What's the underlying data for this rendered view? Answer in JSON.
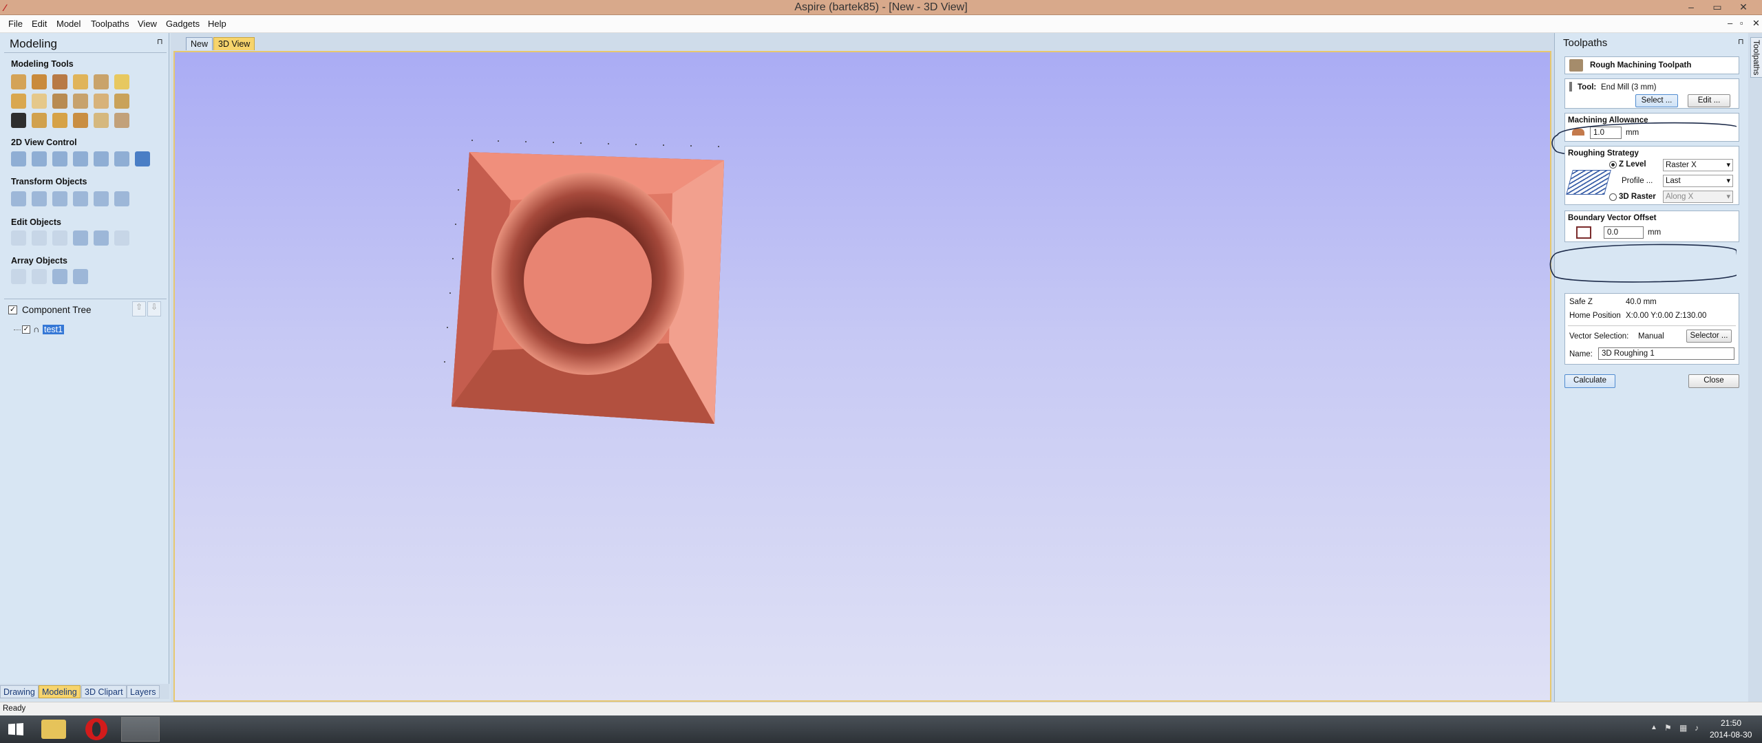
{
  "app": {
    "title": "Aspire (bartek85) - [New - 3D View]"
  },
  "menu": [
    "File",
    "Edit",
    "Model",
    "Toolpaths",
    "View",
    "Gadgets",
    "Help"
  ],
  "left": {
    "title": "Modeling",
    "sections": {
      "modeling_tools": "Modeling Tools",
      "view_control": "2D View Control",
      "transform": "Transform Objects",
      "edit": "Edit Objects",
      "array": "Array Objects"
    },
    "component_tree": "Component Tree",
    "tree_item": "test1",
    "bottom_tabs": [
      "Drawing",
      "Modeling",
      "3D Clipart",
      "Layers"
    ]
  },
  "doc_tabs": [
    "New",
    "3D View"
  ],
  "status": {
    "text": "Ready"
  },
  "right": {
    "title": "Toolpaths",
    "side_tab": "Toolpaths",
    "toolpath_name": "Rough Machining Toolpath",
    "tool": {
      "label": "Tool:",
      "value": "End Mill (3 mm)",
      "select": "Select ...",
      "edit": "Edit ..."
    },
    "allowance": {
      "title": "Machining Allowance",
      "value": "1.0",
      "unit": "mm"
    },
    "strategy": {
      "title": "Roughing Strategy",
      "zlevel": "Z Level",
      "zlevel_option": "Raster X",
      "profile": "Profile ...",
      "profile_option": "Last",
      "raster": "3D Raster",
      "raster_option": "Along X"
    },
    "boundary": {
      "title": "Boundary Vector Offset",
      "value": "0.0",
      "unit": "mm"
    },
    "safe_z": {
      "label": "Safe Z",
      "value": "40.0 mm"
    },
    "home": {
      "label": "Home Position",
      "value": "X:0.00 Y:0.00 Z:130.00"
    },
    "vector_selection": {
      "label": "Vector Selection:",
      "value": "Manual",
      "button": "Selector ..."
    },
    "name": {
      "label": "Name:",
      "value": "3D Roughing 1"
    },
    "calculate": "Calculate",
    "close": "Close"
  },
  "taskbar": {
    "time": "21:50",
    "date": "2014-08-30"
  },
  "colors": {
    "accent_tab": "#f7d46c",
    "viewport_top": "#aaacf4",
    "model": "#e07865"
  }
}
